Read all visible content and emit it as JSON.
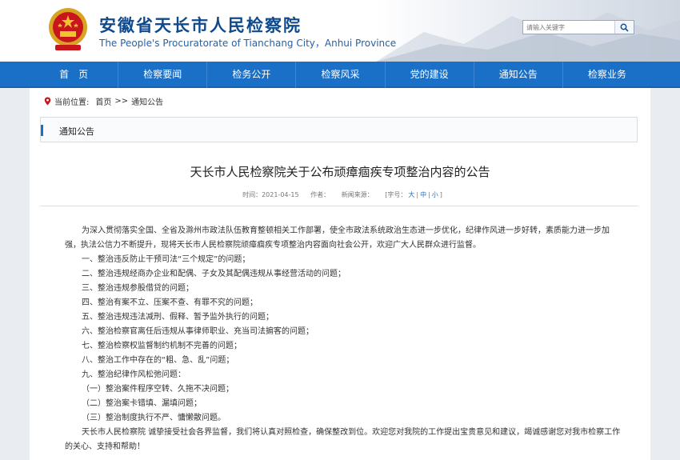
{
  "header": {
    "title": "安徽省天长市人民检察院",
    "subtitle": "The People's Procuratorate of Tianchang City，Anhui Province",
    "search_placeholder": "请输入关键字",
    "emblem_icon": "national-emblem-icon",
    "search_icon": "search-icon"
  },
  "nav": {
    "items": [
      "首　页",
      "检察要闻",
      "检务公开",
      "检察风采",
      "党的建设",
      "通知公告",
      "检察业务"
    ]
  },
  "breadcrumb": {
    "label": "当前位置:",
    "home": "首页",
    "sep": ">>",
    "current": "通知公告",
    "icon": "location-pin-icon"
  },
  "section": {
    "title": "通知公告"
  },
  "article": {
    "title": "天长市人民检察院关于公布顽瘴痼疾专项整治内容的公告",
    "time": "时间：2021-04-15",
    "author": "作者：",
    "source": "新闻来源：",
    "font_size_label": "[字号：",
    "font_large": "大",
    "font_medium": "中",
    "font_small": "小",
    "font_end": "]",
    "intro": "为深入贯彻落实全国、全省及滁州市政法队伍教育整顿相关工作部署，使全市政法系统政治生态进一步优化，纪律作风进一步好转，素质能力进一步加强，执法公信力不断提升，现将天长市人民检察院顽瘴痼疾专项整治内容面向社会公开，欢迎广大人民群众进行监督。",
    "items": [
      "一、整治违反防止干预司法“三个规定”的问题；",
      "二、整治违规经商办企业和配偶、子女及其配偶违规从事经营活动的问题；",
      "三、整治违规参股借贷的问题；",
      "四、整治有案不立、压案不查、有罪不究的问题；",
      "五、整治违规违法减刑、假释、暂予监外执行的问题；",
      "六、整治检察官离任后违规从事律师职业、充当司法掮客的问题；",
      "七、整治检察权监督制约机制不完善的问题；",
      "八、整治工作中存在的“粗、急、乱”问题；",
      "九、整治纪律作风松弛问题：",
      "（一）整治案件程序空转、久拖不决问题；",
      "（二）整治案卡错填、漏填问题；",
      "（三）整治制度执行不严、慵懒散问题。"
    ],
    "closing": "天长市人民检察院 诚挚接受社会各界监督，我们将认真对照检查，确保整改到位。欢迎您对我院的工作提出宝贵意见和建议，竭诚感谢您对我市检察工作的关心、支持和帮助！"
  },
  "colors": {
    "nav": "#1a6fc6",
    "title": "#0f4a8c",
    "link": "#1a6fc6"
  }
}
